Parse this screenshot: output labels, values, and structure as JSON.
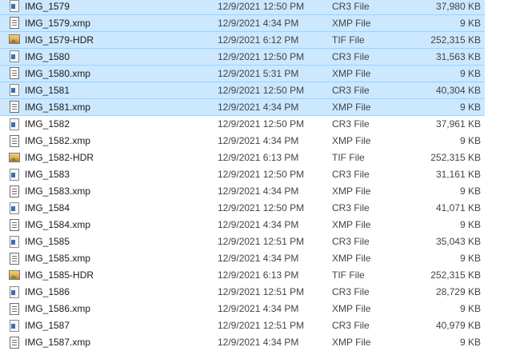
{
  "files": [
    {
      "name": "IMG_1579",
      "date": "12/9/2021 12:50 PM",
      "type": "CR3 File",
      "size": "37,980 KB",
      "icon": "raw-file-icon",
      "selected": true
    },
    {
      "name": "IMG_1579.xmp",
      "date": "12/9/2021 4:34 PM",
      "type": "XMP File",
      "size": "9 KB",
      "icon": "text-document-icon",
      "selected": true
    },
    {
      "name": "IMG_1579-HDR",
      "date": "12/9/2021 6:12 PM",
      "type": "TIF File",
      "size": "252,315 KB",
      "icon": "image-file-icon",
      "selected": true
    },
    {
      "name": "IMG_1580",
      "date": "12/9/2021 12:50 PM",
      "type": "CR3 File",
      "size": "31,563 KB",
      "icon": "raw-file-icon",
      "selected": true
    },
    {
      "name": "IMG_1580.xmp",
      "date": "12/9/2021 5:31 PM",
      "type": "XMP File",
      "size": "9 KB",
      "icon": "text-document-icon",
      "selected": true
    },
    {
      "name": "IMG_1581",
      "date": "12/9/2021 12:50 PM",
      "type": "CR3 File",
      "size": "40,304 KB",
      "icon": "raw-file-icon",
      "selected": true
    },
    {
      "name": "IMG_1581.xmp",
      "date": "12/9/2021 4:34 PM",
      "type": "XMP File",
      "size": "9 KB",
      "icon": "text-document-icon",
      "selected": true
    },
    {
      "name": "IMG_1582",
      "date": "12/9/2021 12:50 PM",
      "type": "CR3 File",
      "size": "37,961 KB",
      "icon": "raw-file-icon",
      "selected": false
    },
    {
      "name": "IMG_1582.xmp",
      "date": "12/9/2021 4:34 PM",
      "type": "XMP File",
      "size": "9 KB",
      "icon": "text-document-icon",
      "selected": false
    },
    {
      "name": "IMG_1582-HDR",
      "date": "12/9/2021 6:13 PM",
      "type": "TIF File",
      "size": "252,315 KB",
      "icon": "image-file-icon",
      "selected": false
    },
    {
      "name": "IMG_1583",
      "date": "12/9/2021 12:50 PM",
      "type": "CR3 File",
      "size": "31,161 KB",
      "icon": "raw-file-icon",
      "selected": false
    },
    {
      "name": "IMG_1583.xmp",
      "date": "12/9/2021 4:34 PM",
      "type": "XMP File",
      "size": "9 KB",
      "icon": "text-document-icon",
      "selected": false
    },
    {
      "name": "IMG_1584",
      "date": "12/9/2021 12:50 PM",
      "type": "CR3 File",
      "size": "41,071 KB",
      "icon": "raw-file-icon",
      "selected": false
    },
    {
      "name": "IMG_1584.xmp",
      "date": "12/9/2021 4:34 PM",
      "type": "XMP File",
      "size": "9 KB",
      "icon": "text-document-icon",
      "selected": false
    },
    {
      "name": "IMG_1585",
      "date": "12/9/2021 12:51 PM",
      "type": "CR3 File",
      "size": "35,043 KB",
      "icon": "raw-file-icon",
      "selected": false
    },
    {
      "name": "IMG_1585.xmp",
      "date": "12/9/2021 4:34 PM",
      "type": "XMP File",
      "size": "9 KB",
      "icon": "text-document-icon",
      "selected": false
    },
    {
      "name": "IMG_1585-HDR",
      "date": "12/9/2021 6:13 PM",
      "type": "TIF File",
      "size": "252,315 KB",
      "icon": "image-file-icon",
      "selected": false
    },
    {
      "name": "IMG_1586",
      "date": "12/9/2021 12:51 PM",
      "type": "CR3 File",
      "size": "28,729 KB",
      "icon": "raw-file-icon",
      "selected": false
    },
    {
      "name": "IMG_1586.xmp",
      "date": "12/9/2021 4:34 PM",
      "type": "XMP File",
      "size": "9 KB",
      "icon": "text-document-icon",
      "selected": false
    },
    {
      "name": "IMG_1587",
      "date": "12/9/2021 12:51 PM",
      "type": "CR3 File",
      "size": "40,979 KB",
      "icon": "raw-file-icon",
      "selected": false
    },
    {
      "name": "IMG_1587.xmp",
      "date": "12/9/2021 4:34 PM",
      "type": "XMP File",
      "size": "9 KB",
      "icon": "text-document-icon",
      "selected": false
    }
  ],
  "colors": {
    "selection_background": "#cce8ff",
    "selection_border": "#99d1ff"
  }
}
